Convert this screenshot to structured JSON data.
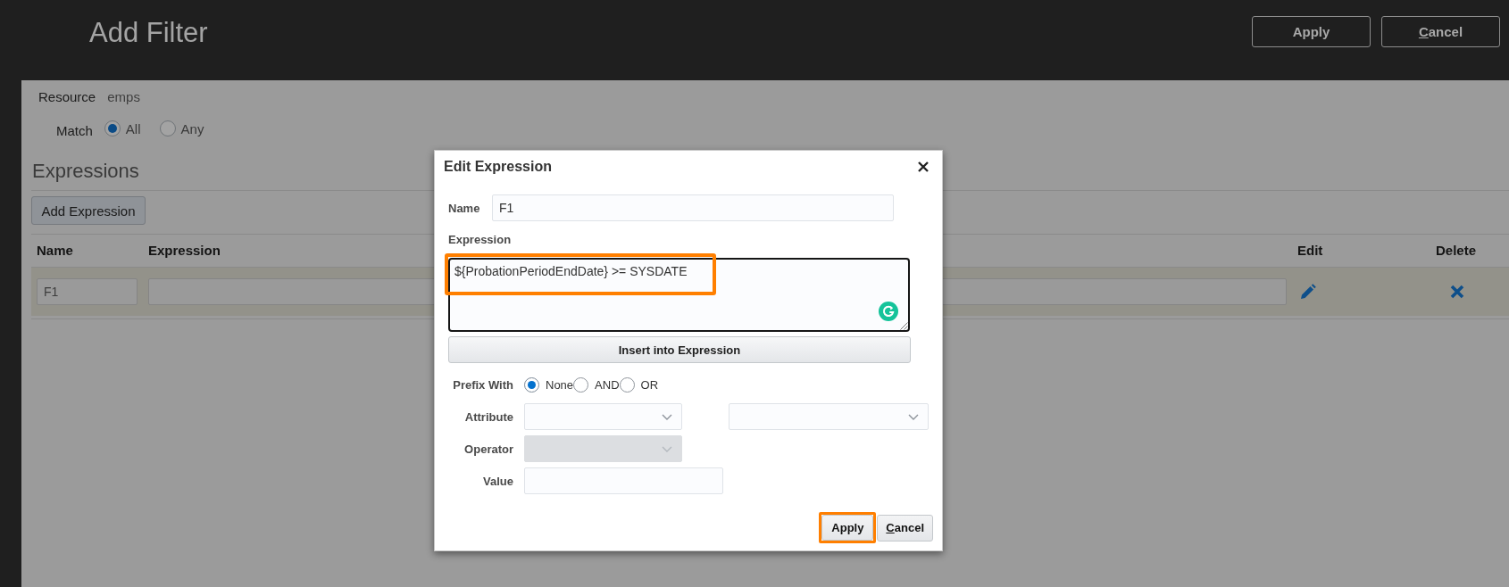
{
  "header": {
    "title": "Add Filter",
    "buttons": [
      {
        "label": "Apply",
        "mnemonic": false
      },
      {
        "label": "Cancel",
        "mnemonic": true
      }
    ]
  },
  "filter": {
    "resource_label": "Resource",
    "resource": "emps",
    "match_label": "Match",
    "match_options": [
      {
        "label": "All",
        "selected": true
      },
      {
        "label": "Any",
        "selected": false
      }
    ]
  },
  "expressions": {
    "heading": "Expressions",
    "add_button": "Add Expression",
    "columns": [
      "Name",
      "Expression",
      "Edit",
      "Delete"
    ],
    "rows": [
      {
        "name": "F1"
      }
    ]
  },
  "dialog": {
    "title": "Edit Expression",
    "name_label": "Name",
    "name": "F1",
    "expression_label": "Expression",
    "expression": "${ProbationPeriodEndDate} >= SYSDATE",
    "expression_highlighted": true,
    "insert_button": "Insert into Expression",
    "prefix_label": "Prefix With",
    "prefix_options": [
      {
        "label": "None",
        "selected": true
      },
      {
        "label": "AND",
        "selected": false
      },
      {
        "label": "OR",
        "selected": false
      }
    ],
    "fields": [
      {
        "label": "Attribute",
        "kind": "select_pair",
        "disabled": false
      },
      {
        "label": "Operator",
        "kind": "select",
        "disabled": true
      },
      {
        "label": "Value",
        "kind": "input",
        "disabled": false
      }
    ],
    "buttons": [
      {
        "label": "Apply",
        "mnemonic": false,
        "highlighted": true
      },
      {
        "label": "Cancel",
        "mnemonic": true,
        "highlighted": false
      }
    ]
  }
}
